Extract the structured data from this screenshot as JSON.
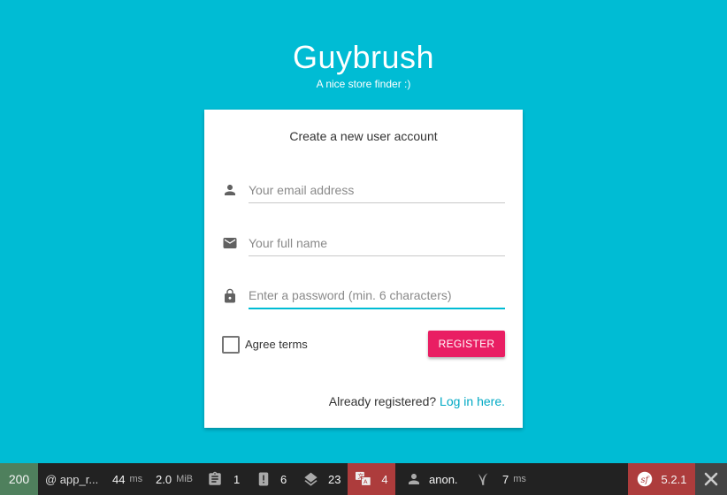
{
  "brand": {
    "title": "Guybrush",
    "tagline": "A nice store finder :)"
  },
  "form": {
    "heading": "Create a new user account",
    "email": {
      "placeholder": "Your email address",
      "icon": "person-icon"
    },
    "fullname": {
      "placeholder": "Your full name",
      "icon": "mail-icon"
    },
    "password": {
      "placeholder": "Enter a password (min. 6 characters)",
      "icon": "lock-icon"
    },
    "terms_label": "Agree terms",
    "register_label": "REGISTER",
    "login_prompt": "Already registered?",
    "login_link": "Log in here."
  },
  "toolbar": {
    "status_code": "200",
    "route": "@ app_r...",
    "time": {
      "value": "44",
      "unit": "ms"
    },
    "memory": {
      "value": "2.0",
      "unit": "MiB"
    },
    "forms": "1",
    "validator": "6",
    "cache": "23",
    "translation": "4",
    "user": "anon.",
    "twig": {
      "value": "7",
      "unit": "ms"
    },
    "version": "5.2.1"
  },
  "colors": {
    "background": "#00bcd4",
    "accent": "#e91e63",
    "toolbar": "#222222",
    "status_ok": "#4f805d",
    "toolbar_warning": "#ad3c3c"
  }
}
